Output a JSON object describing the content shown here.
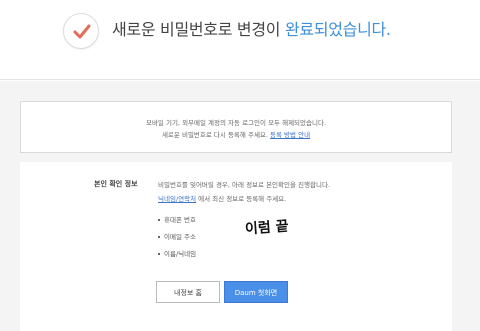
{
  "header": {
    "headline_prefix": "새로운 비밀번호로 변경이 ",
    "headline_accent": "완료되었습니다.",
    "accent_color": "#3d8fd8",
    "icon": "check-icon"
  },
  "notice": {
    "line1": "모바일 기기, 외부메일 계정의 자동 로그인이 모두 해제되었습니다.",
    "line2_prefix": "새로운 비밀번호로 다시 등록해 주세요. ",
    "line2_link": "등록 방법 안내"
  },
  "identity": {
    "title": "본인 확인 정보",
    "desc1": "비밀번호를 잊어버릴 경우, 아래 정보로 본인확인을 진행합니다.",
    "desc2_link": "닉네임/연락처",
    "desc2_suffix": " 에서 최신 정보로 등록해 주세요.",
    "items": [
      "휴대폰 번호",
      "이메일 주소",
      "이름/닉네임"
    ],
    "handwriting": "이럼 끝"
  },
  "buttons": {
    "my_info": "내정보 홈",
    "daum_home": "Daum 첫화면"
  }
}
